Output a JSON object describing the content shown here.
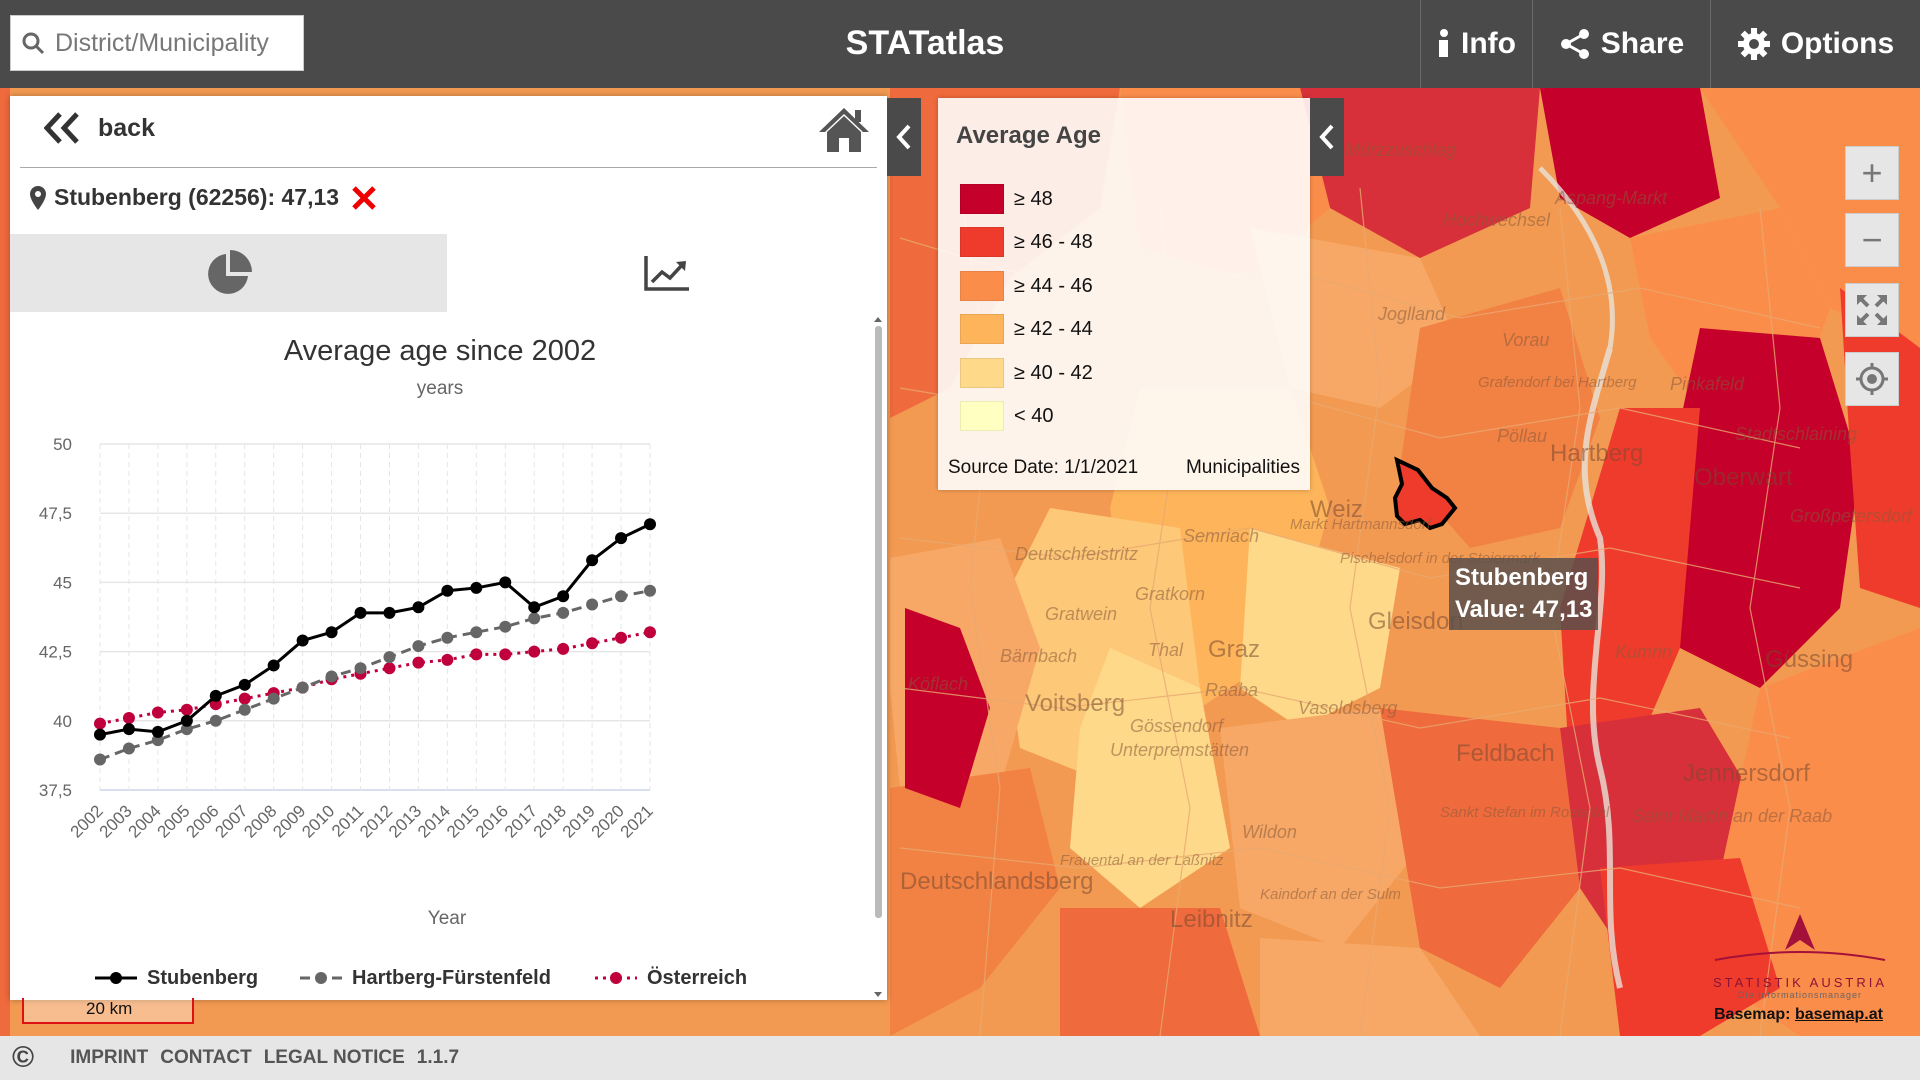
{
  "app": {
    "title": "STATatlas"
  },
  "search": {
    "placeholder": "District/Municipality"
  },
  "toolbar": {
    "info_label": "Info",
    "share_label": "Share",
    "options_label": "Options"
  },
  "panel": {
    "back_label": "back",
    "selection": "Stubenberg (62256): 47,13",
    "tabs": [
      {
        "icon": "pie-chart-icon"
      },
      {
        "icon": "line-chart-icon",
        "active": true
      }
    ]
  },
  "legend": {
    "title": "Average Age",
    "classes": [
      {
        "label": "≥ 48",
        "color": "#c5002a"
      },
      {
        "label": "≥ 46 - 48",
        "color": "#ef3b2c"
      },
      {
        "label": "≥ 44 - 46",
        "color": "#fb8d4b"
      },
      {
        "label": "≥ 42 - 44",
        "color": "#fdb45a"
      },
      {
        "label": "≥ 40 - 42",
        "color": "#fed98a"
      },
      {
        "label": "< 40",
        "color": "#ffffc2"
      }
    ],
    "source": "Source Date: 1/1/2021",
    "level": "Municipalities"
  },
  "tooltip": {
    "name": "Stubenberg",
    "value": "Value: 47,13"
  },
  "map": {
    "places": [
      "Mürzzuschlag",
      "Hochwechsel",
      "Joglland",
      "Vorau",
      "Grafendorf bei Hartberg",
      "Pöllau",
      "Hartberg",
      "Pinkafeld",
      "Oberwart",
      "Weiz",
      "Gleisdorf",
      "Graz",
      "Voitsberg",
      "Feldbach",
      "Jennersdorf",
      "Güssing",
      "Deutschlandsberg",
      "Leibnitz",
      "Sankt Stefan im Rosental",
      "Gratkorn",
      "Semriach",
      "Kaindorf an der Sulm",
      "Großpetersdorf",
      "Pischelsdorf in der Steiermark",
      "Markt Hartmannsdorf",
      "Kumrin",
      "Saint Martin an der Raab",
      "Gössendorf",
      "Unterpremstätten",
      "Frauental an der Laßnitz",
      "Wildon",
      "Köflach",
      "Bärnbach",
      "Vasoldsberg",
      "Raaba",
      "Thal",
      "Gratwein",
      "Deutschfeistritz",
      "Stadtschlaining",
      "Aspang-Markt"
    ],
    "scale": "20 km",
    "logo": "STATISTIK AUSTRIA",
    "logo_sub": "Die Informationsmanager",
    "basemap_prefix": "Basemap:",
    "basemap_link": "basemap.at"
  },
  "footer": {
    "links": [
      "IMPRINT",
      "CONTACT",
      "LEGAL NOTICE",
      "1.1.7"
    ]
  },
  "chart_data": {
    "type": "line",
    "title": "Average age since 2002",
    "subtitle": "years",
    "xlabel": "Year",
    "ylabel": "",
    "ylim": [
      37.5,
      50
    ],
    "yticks": [
      "37,5",
      "40",
      "42,5",
      "45",
      "47,5",
      "50"
    ],
    "ytick_values": [
      37.5,
      40,
      42.5,
      45,
      47.5,
      50
    ],
    "legend_position": "bottom",
    "grid": true,
    "categories": [
      "2002",
      "2003",
      "2004",
      "2005",
      "2006",
      "2007",
      "2008",
      "2009",
      "2010",
      "2011",
      "2012",
      "2013",
      "2014",
      "2015",
      "2016",
      "2017",
      "2018",
      "2019",
      "2020",
      "2021"
    ],
    "series": [
      {
        "name": "Stubenberg",
        "color": "#000000",
        "style": "solid",
        "values": [
          39.5,
          39.7,
          39.6,
          40.0,
          40.9,
          41.3,
          42.0,
          42.9,
          43.2,
          43.9,
          43.9,
          44.1,
          44.7,
          44.8,
          45.0,
          44.1,
          44.5,
          45.8,
          46.6,
          47.1
        ]
      },
      {
        "name": "Hartberg-Fürstenfeld",
        "color": "#666666",
        "style": "dashed",
        "values": [
          38.6,
          39.0,
          39.3,
          39.7,
          40.0,
          40.4,
          40.8,
          41.2,
          41.6,
          41.9,
          42.3,
          42.7,
          43.0,
          43.2,
          43.4,
          43.7,
          43.9,
          44.2,
          44.5,
          44.7
        ]
      },
      {
        "name": "Österreich",
        "color": "#c0003c",
        "style": "dotted",
        "values": [
          39.9,
          40.1,
          40.3,
          40.4,
          40.6,
          40.8,
          41.0,
          41.2,
          41.5,
          41.7,
          41.9,
          42.1,
          42.2,
          42.4,
          42.4,
          42.5,
          42.6,
          42.8,
          43.0,
          43.2
        ]
      }
    ]
  }
}
